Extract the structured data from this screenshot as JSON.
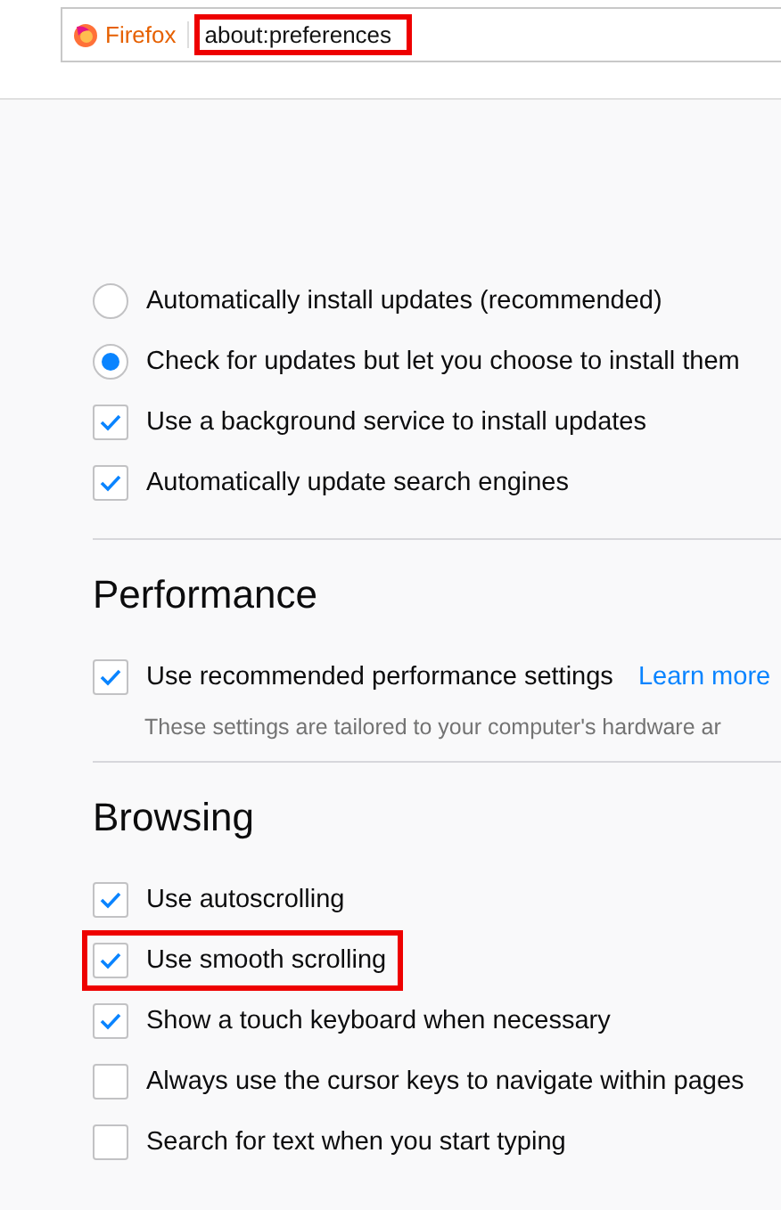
{
  "address_bar": {
    "browser_label": "Firefox",
    "url": "about:preferences",
    "highlighted": true
  },
  "sections": [
    {
      "items": [
        {
          "kind": "radio",
          "label": "Automatically install updates (recommended)",
          "selected": false,
          "highlighted": false
        },
        {
          "kind": "radio",
          "label": "Check for updates but let you choose to install them",
          "selected": true,
          "highlighted": false
        },
        {
          "kind": "checkbox",
          "label": "Use a background service to install updates",
          "checked": true,
          "highlighted": false
        },
        {
          "kind": "checkbox",
          "label": "Automatically update search engines",
          "checked": true,
          "highlighted": false
        }
      ]
    },
    {
      "heading": "Performance",
      "items": [
        {
          "kind": "checkbox",
          "label": "Use recommended performance settings",
          "checked": true,
          "highlighted": false,
          "link": "Learn more",
          "description": "These settings are tailored to your computer's hardware ar"
        }
      ]
    },
    {
      "heading": "Browsing",
      "items": [
        {
          "kind": "checkbox",
          "label": "Use autoscrolling",
          "checked": true,
          "highlighted": false
        },
        {
          "kind": "checkbox",
          "label": "Use smooth scrolling",
          "checked": true,
          "highlighted": true
        },
        {
          "kind": "checkbox",
          "label": "Show a touch keyboard when necessary",
          "checked": true,
          "highlighted": false
        },
        {
          "kind": "checkbox",
          "label": "Always use the cursor keys to navigate within pages",
          "checked": false,
          "highlighted": false
        },
        {
          "kind": "checkbox",
          "label": "Search for text when you start typing",
          "checked": false,
          "highlighted": false
        }
      ]
    }
  ]
}
